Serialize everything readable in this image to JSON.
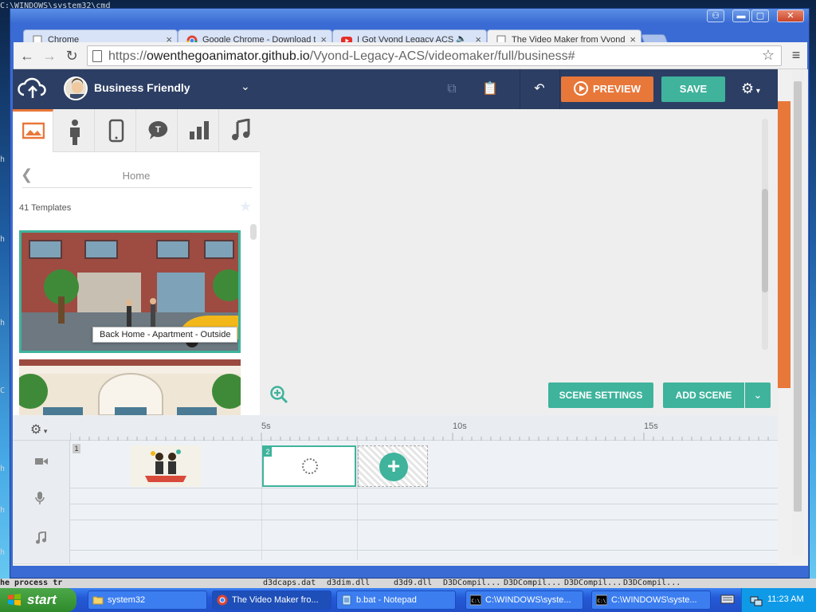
{
  "desktop": {
    "fragments": [
      "C:\\WINDOWS\\system32\\cmd",
      "h",
      "h",
      "h",
      "C",
      "h",
      "h",
      "h",
      "he process tr"
    ]
  },
  "window": {
    "controls": {
      "user": "⚇",
      "minimize": "▬",
      "maximize": "▢",
      "close": "✕"
    }
  },
  "tabs": [
    {
      "label": "Chrome",
      "icon": "page-icon"
    },
    {
      "label": "Google Chrome - Download t",
      "icon": "chrome-icon"
    },
    {
      "label": "I Got Vyond Legacy ACS",
      "icon": "youtube-icon",
      "audio": "🔈"
    },
    {
      "label": "The Video Maker from Vyond",
      "icon": "page-icon",
      "active": true
    }
  ],
  "toolbar": {
    "url_prefix": "https://",
    "url_host": "owenthegoanimator.github.io",
    "url_path": "/Vyond-Legacy-ACS/videomaker/full/business#",
    "back": "←",
    "forward": "→",
    "reload": "↻",
    "star": "☆",
    "menu": "≡"
  },
  "app": {
    "theme_name": "Business Friendly",
    "preview_label": "PREVIEW",
    "save_label": "SAVE",
    "panel": {
      "home_label": "Home",
      "templates_count": "41 Templates",
      "tooltip": "Back Home - Apartment - Outside",
      "category_tabs": [
        "image-icon",
        "character-icon",
        "prop-icon",
        "text-bubble-icon",
        "chart-icon",
        "music-icon"
      ]
    },
    "stage": {
      "scene_settings_label": "SCENE SETTINGS",
      "add_scene_label": "ADD SCENE"
    },
    "timeline": {
      "ticks": [
        "5s",
        "10s",
        "15s"
      ],
      "scene_numbers": [
        "1",
        "2"
      ],
      "row_icons": [
        "video-camera-icon",
        "microphone-icon",
        "music-note-icon"
      ]
    }
  },
  "taskbar": {
    "start_label": "start",
    "tasks": [
      {
        "label": "system32",
        "icon": "folder-icon"
      },
      {
        "label": "The Video Maker fro...",
        "icon": "chrome-icon"
      },
      {
        "label": "b.bat - Notepad",
        "icon": "notepad-icon"
      },
      {
        "label": "C:\\WINDOWS\\syste...",
        "icon": "cmd-icon"
      },
      {
        "label": "C:\\WINDOWS\\syste...",
        "icon": "cmd-icon"
      }
    ],
    "clock": "11:23 AM"
  },
  "behind_files": [
    "d3dcaps.dat",
    "d3dim.dll",
    "d3d9.dll",
    "D3DCompil...",
    "D3DCompil...",
    "D3DCompil...",
    "D3DCompil...",
    "D3DCompil..."
  ],
  "colors": {
    "accent_teal": "#3fb39c",
    "accent_orange": "#e8773a",
    "app_nav": "#2c3e63"
  }
}
